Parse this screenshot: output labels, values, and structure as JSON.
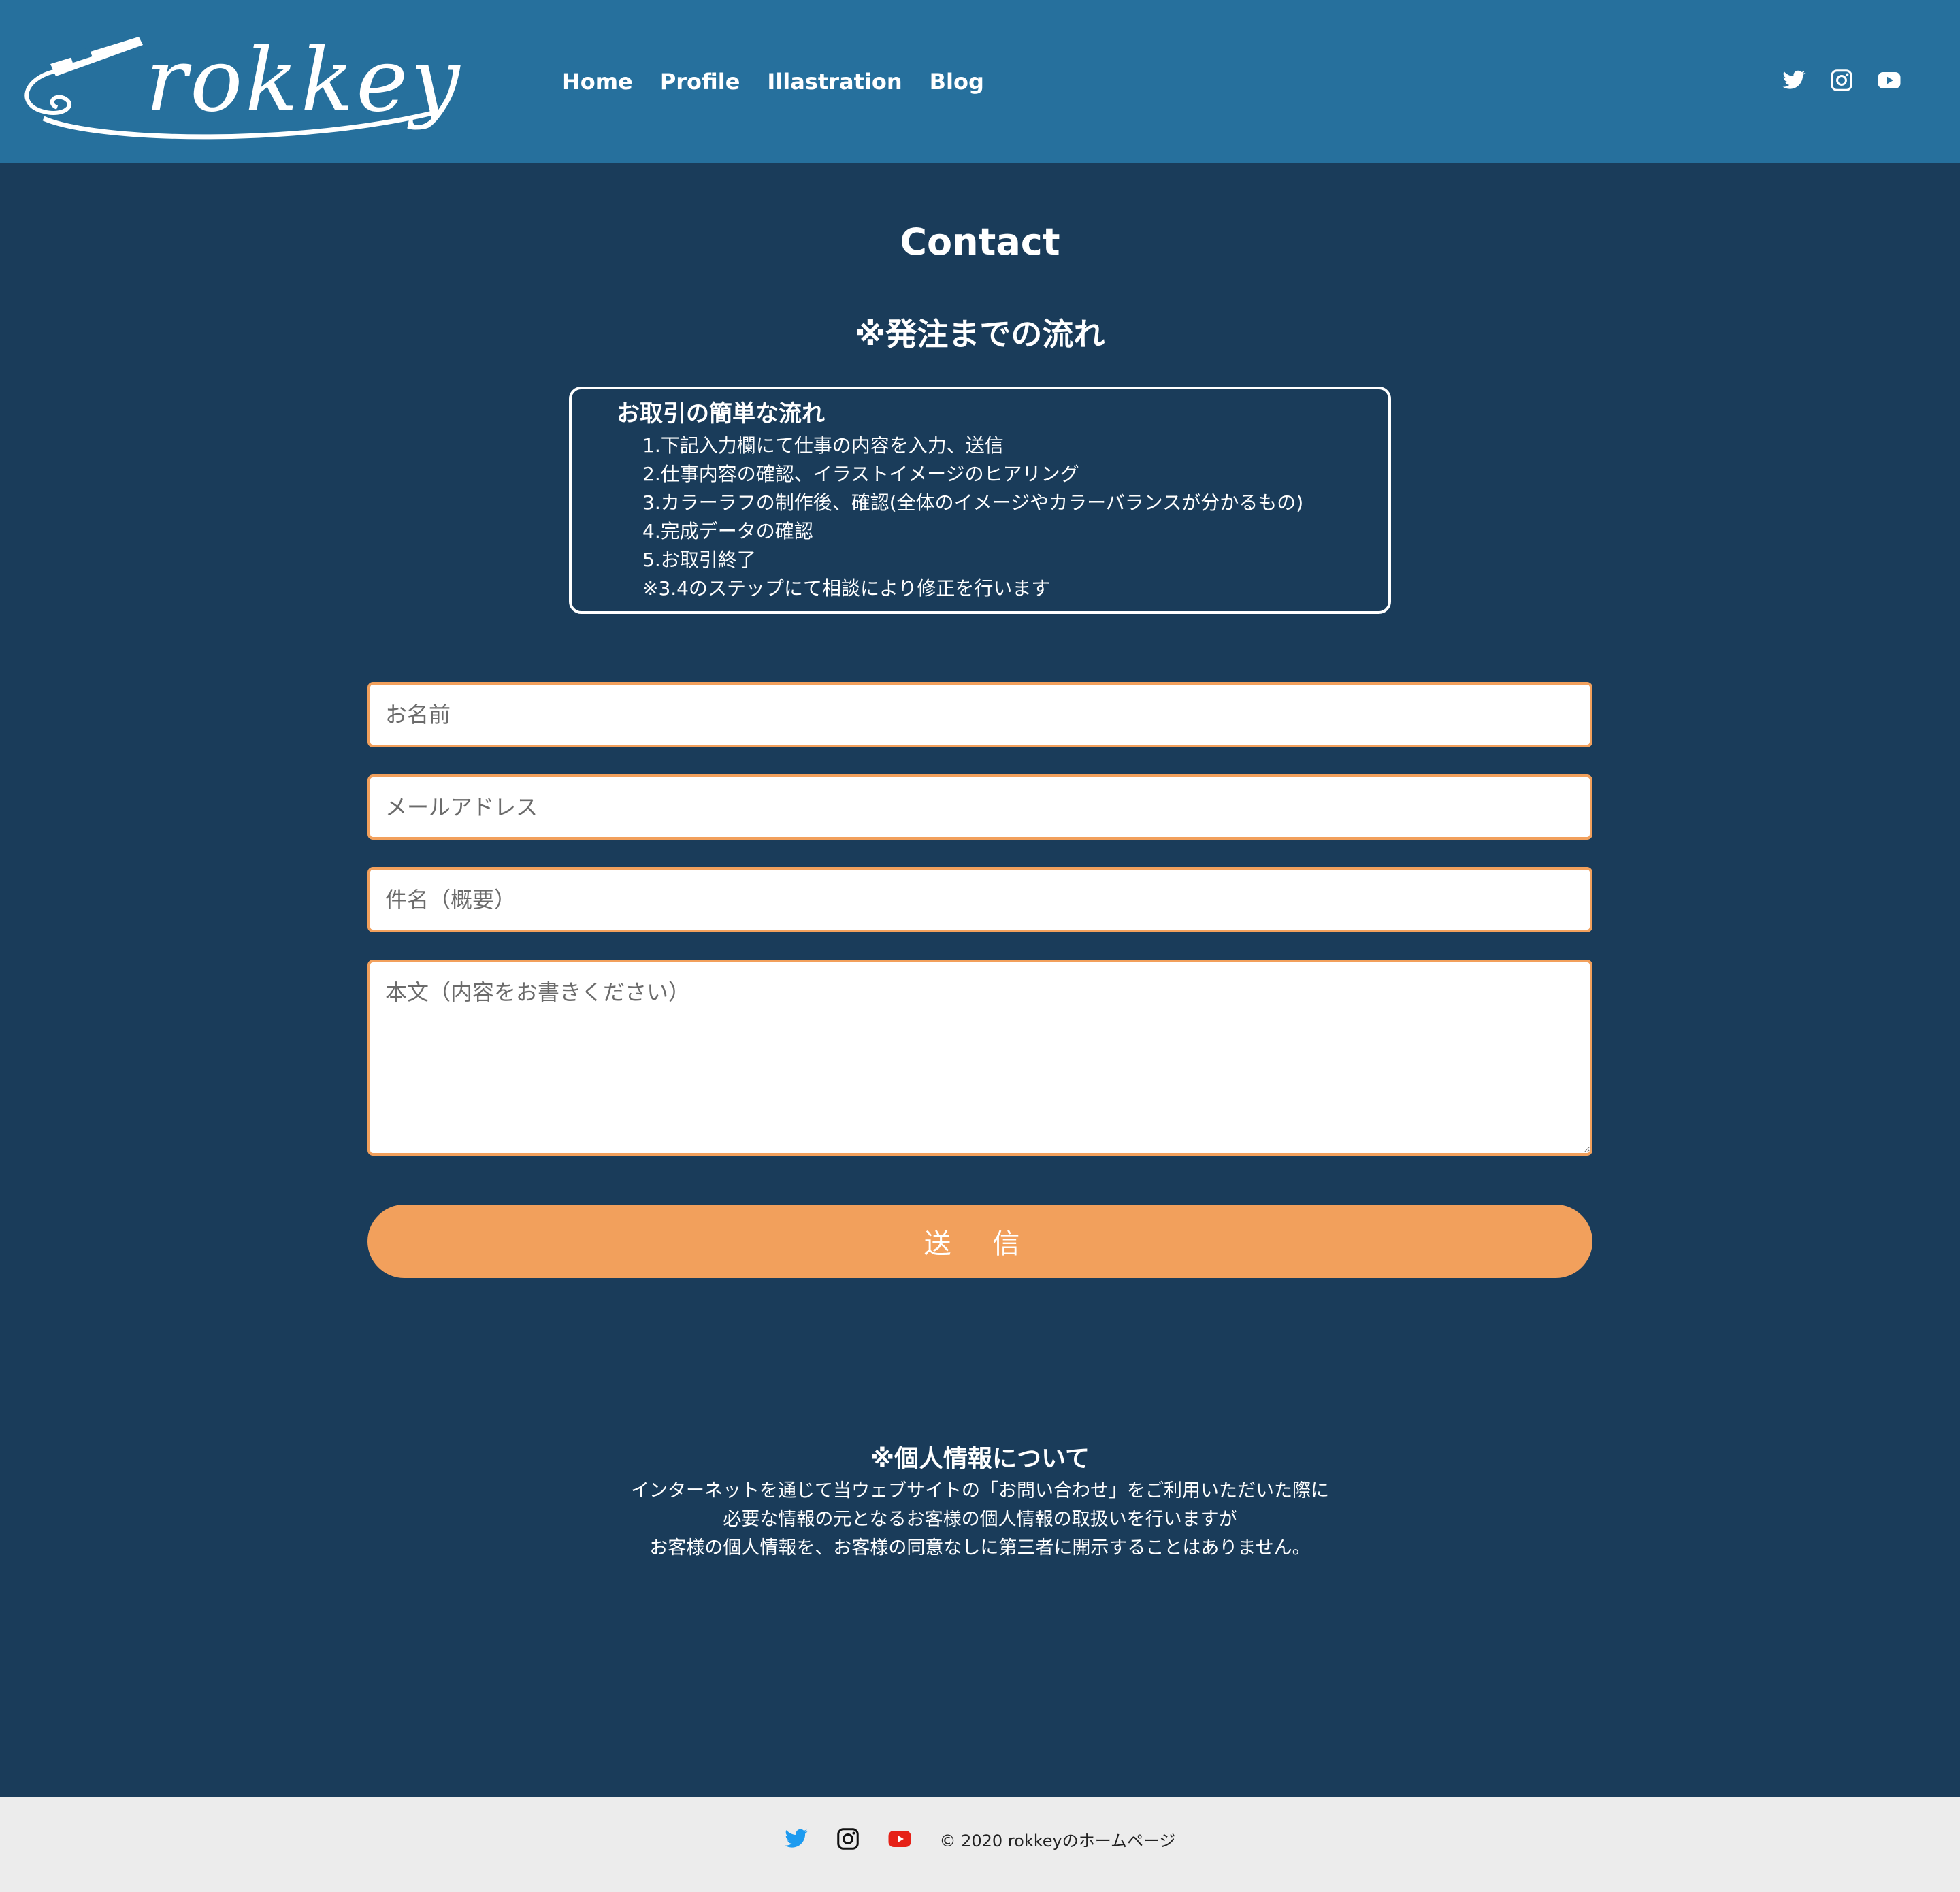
{
  "header": {
    "logo_text": "rokkey",
    "nav": [
      "Home",
      "Profile",
      "Illastration",
      "Blog"
    ],
    "social": [
      "twitter-icon",
      "instagram-icon",
      "youtube-icon"
    ],
    "background": "#26709d"
  },
  "main": {
    "title": "Contact",
    "subtitle": "※発注までの流れ",
    "flow": {
      "title": "お取引の簡単な流れ",
      "steps": [
        "1.下記入力欄にて仕事の内容を入力、送信",
        "2.仕事内容の確認、イラストイメージのヒアリング",
        "3.カラーラフの制作後、確認(全体のイメージやカラーバランスが分かるもの)",
        "4.完成データの確認",
        "5.お取引終了",
        "※3.4のステップにて相談により修正を行います"
      ]
    },
    "form": {
      "name_placeholder": "お名前",
      "email_placeholder": "メールアドレス",
      "subject_placeholder": "件名（概要）",
      "body_placeholder": "本文（内容をお書きください）",
      "submit_label": "送 信"
    },
    "privacy": {
      "title": "※個人情報について",
      "lines": [
        "インターネットを通じて当ウェブサイトの「お問い合わせ」をご利用いただいた際に",
        "必要な情報の元となるお客様の個人情報の取扱いを行いますが",
        "お客様の個人情報を、お客様の同意なしに第三者に開示することはありません。"
      ]
    }
  },
  "footer": {
    "copyright": "© 2020 rokkeyのホームページ",
    "social": [
      "twitter-icon",
      "instagram-icon",
      "youtube-icon"
    ]
  },
  "colors": {
    "page_bg": "#1a3c5a",
    "accent": "#f2a05c",
    "footer_bg": "#ececec"
  }
}
